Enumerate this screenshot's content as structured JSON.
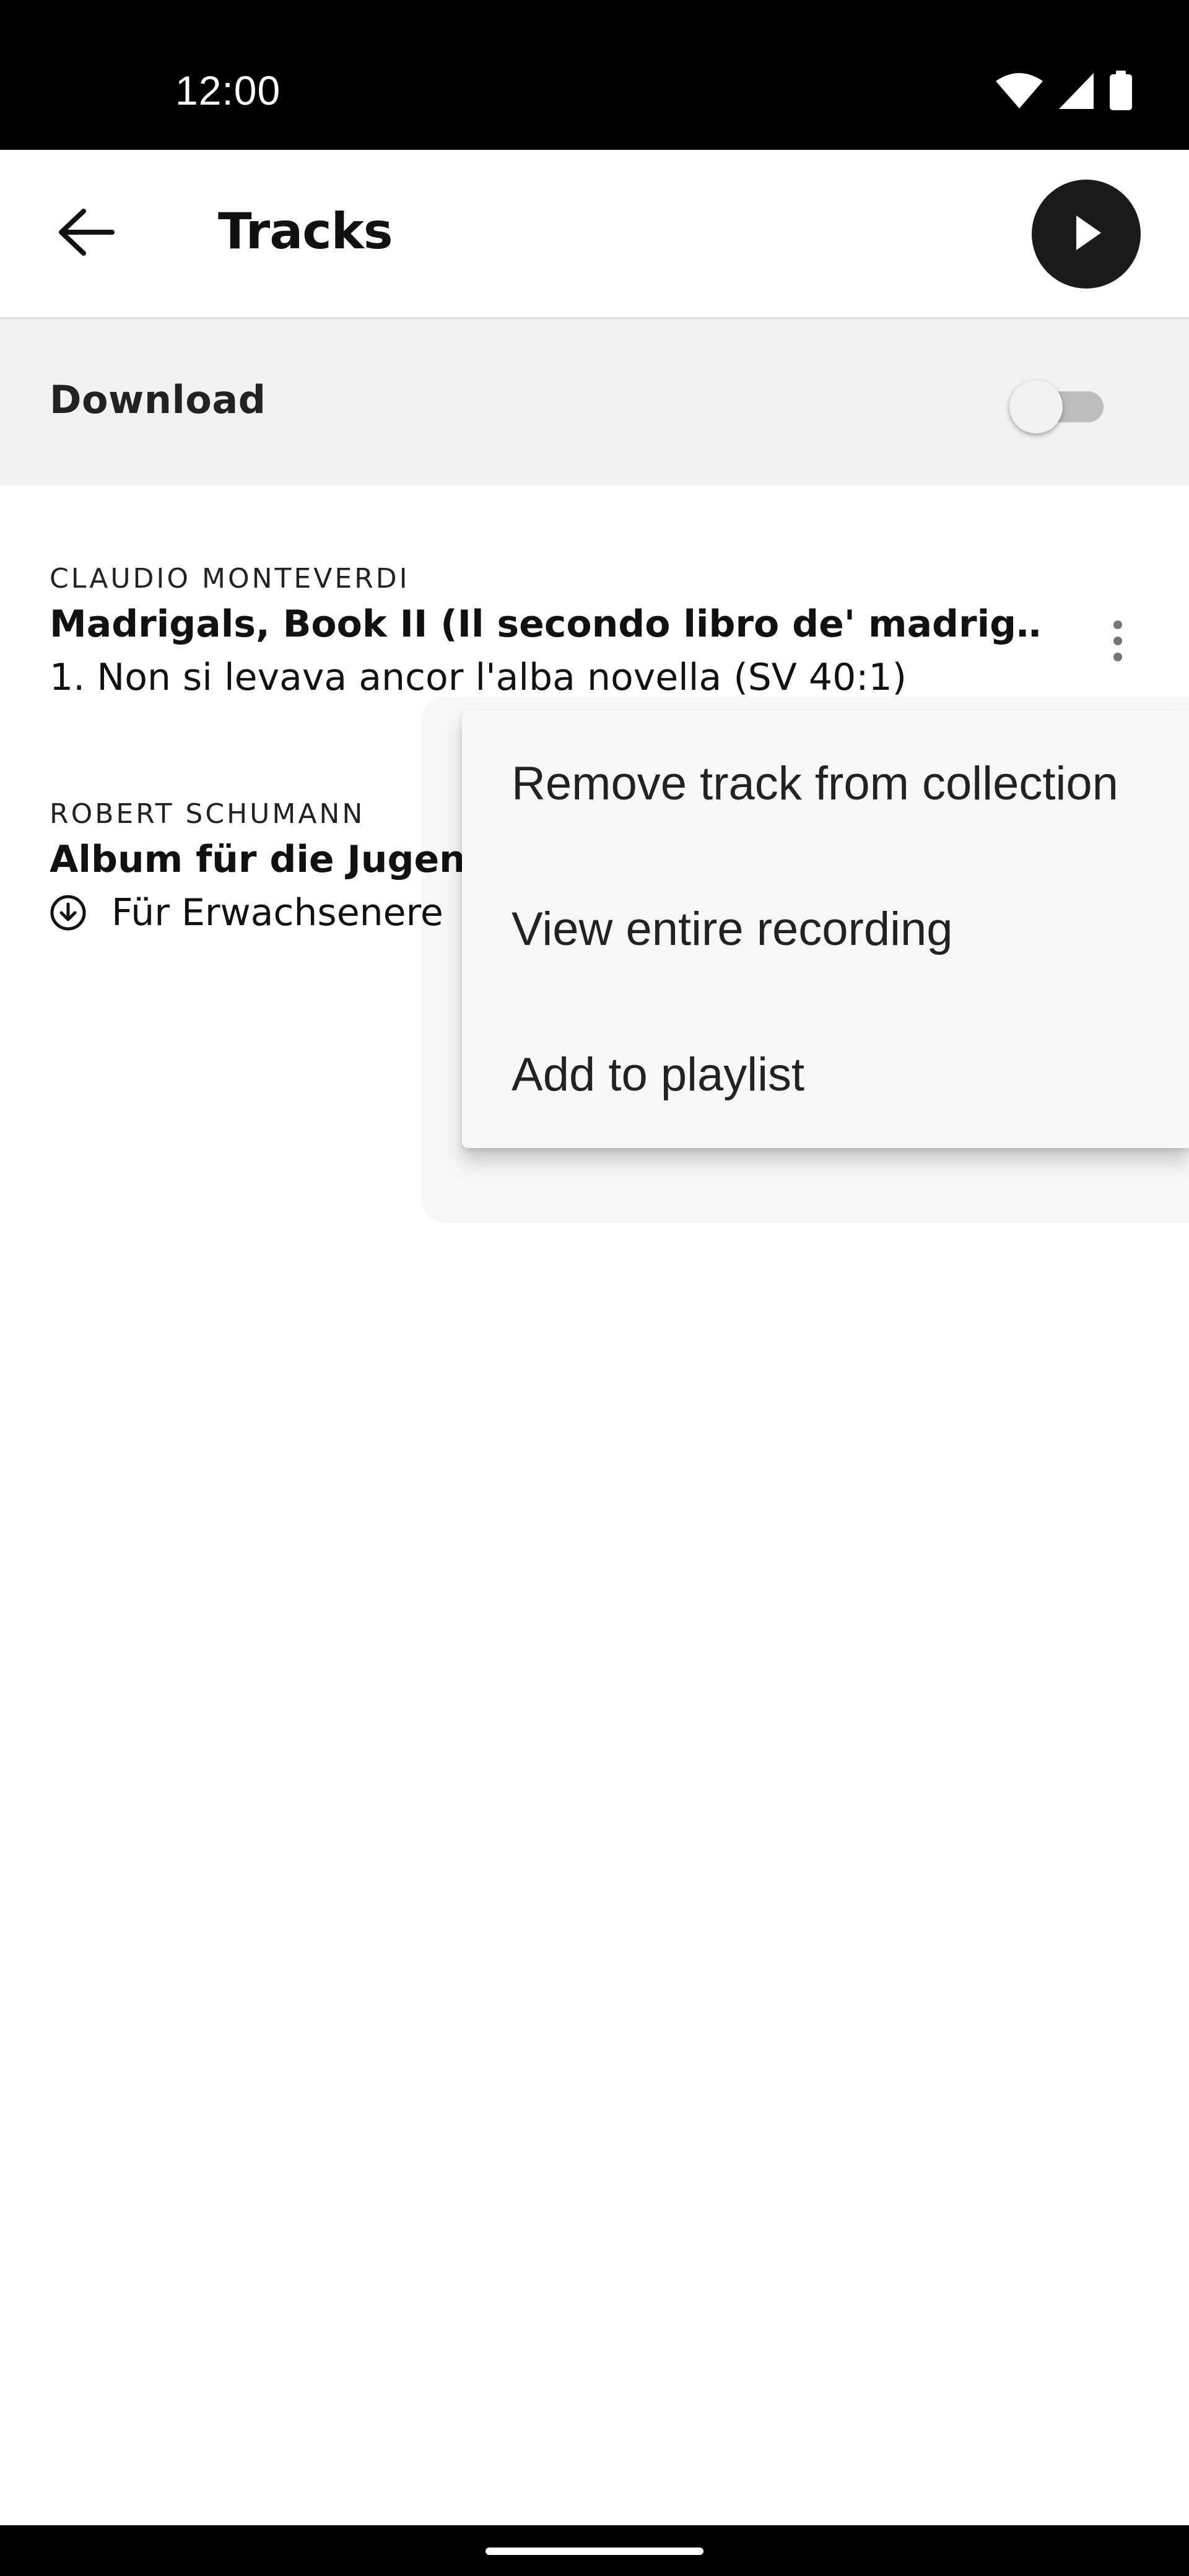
{
  "status_bar": {
    "time": "12:00",
    "icons": [
      "wifi-icon",
      "signal-icon",
      "battery-icon"
    ]
  },
  "app_bar": {
    "title": "Tracks",
    "back_icon": "arrow-back-icon",
    "play_icon": "play-icon"
  },
  "download": {
    "label": "Download",
    "enabled": false
  },
  "tracks": [
    {
      "composer": "CLAUDIO MONTEVERDI",
      "work": "Madrigals, Book II (Il secondo libro de' madrig…",
      "movement": "1. Non si levava ancor l'alba novella (SV 40:1)",
      "downloaded": false
    },
    {
      "composer": "ROBERT SCHUMANN",
      "work": "Album für die Jugend",
      "movement": "Für Erwachsenere",
      "downloaded": true
    }
  ],
  "menu": {
    "items": [
      {
        "label": "Remove track from collection"
      },
      {
        "label": "View entire recording"
      },
      {
        "label": "Add to playlist"
      }
    ]
  },
  "colors": {
    "status_bar_bg": "#000000",
    "download_row_bg": "#f2f2f3",
    "play_button_bg": "#1b1b1b",
    "menu_bg": "#f8f8f8"
  }
}
